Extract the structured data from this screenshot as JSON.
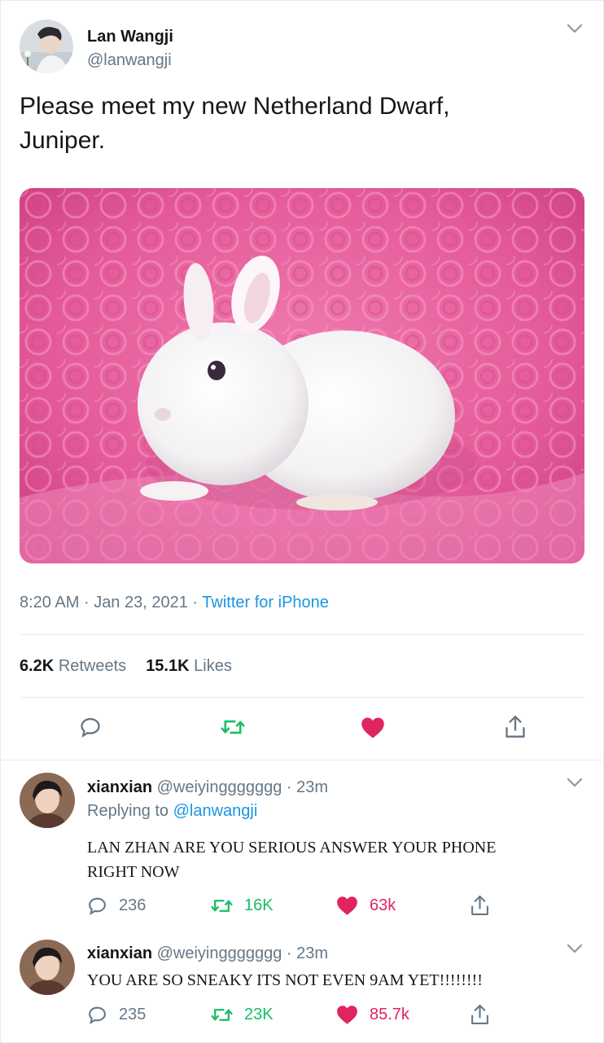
{
  "main_tweet": {
    "author_name": "Lan Wangji",
    "author_handle": "@lanwangji",
    "text_line1": "Please meet my new Netherland Dwarf,",
    "text_line2": "Juniper.",
    "time": "8:20 AM",
    "date": "Jan 23, 2021",
    "separator": "·",
    "source": "Twitter for iPhone",
    "retweets_count": "6.2K",
    "retweets_label": "Retweets",
    "likes_count": "15.1K",
    "likes_label": "Likes"
  },
  "replies": [
    {
      "author_name": "xianxian",
      "author_handle": "@weiyinggggggg",
      "age": "23m",
      "replying_prefix": "Replying to",
      "replying_to": "@lanwangji",
      "text_line1": "LAN ZHAN ARE YOU SERIOUS ANSWER YOUR PHONE",
      "text_line2": "RIGHT NOW",
      "reply_count": "236",
      "retweet_count": "16K",
      "like_count": "63k"
    },
    {
      "author_name": "xianxian",
      "author_handle": "@weiyinggggggg",
      "age": "23m",
      "text_line1": "YOU ARE SO SNEAKY ITS NOT EVEN 9AM YET!!!!!!!!",
      "reply_count": "235",
      "retweet_count": "23K",
      "like_count": "85.7k"
    }
  ],
  "icons": {
    "reply": "speech-bubble-icon",
    "retweet": "retweet-arrows-icon",
    "like": "heart-icon",
    "share": "share-upload-icon",
    "menu": "chevron-down-icon"
  },
  "colors": {
    "text": "#14171a",
    "secondary": "#657786",
    "link": "#1b95e0",
    "retweet": "#17bf63",
    "like": "#e0245e",
    "divider": "#e6ecf0"
  }
}
